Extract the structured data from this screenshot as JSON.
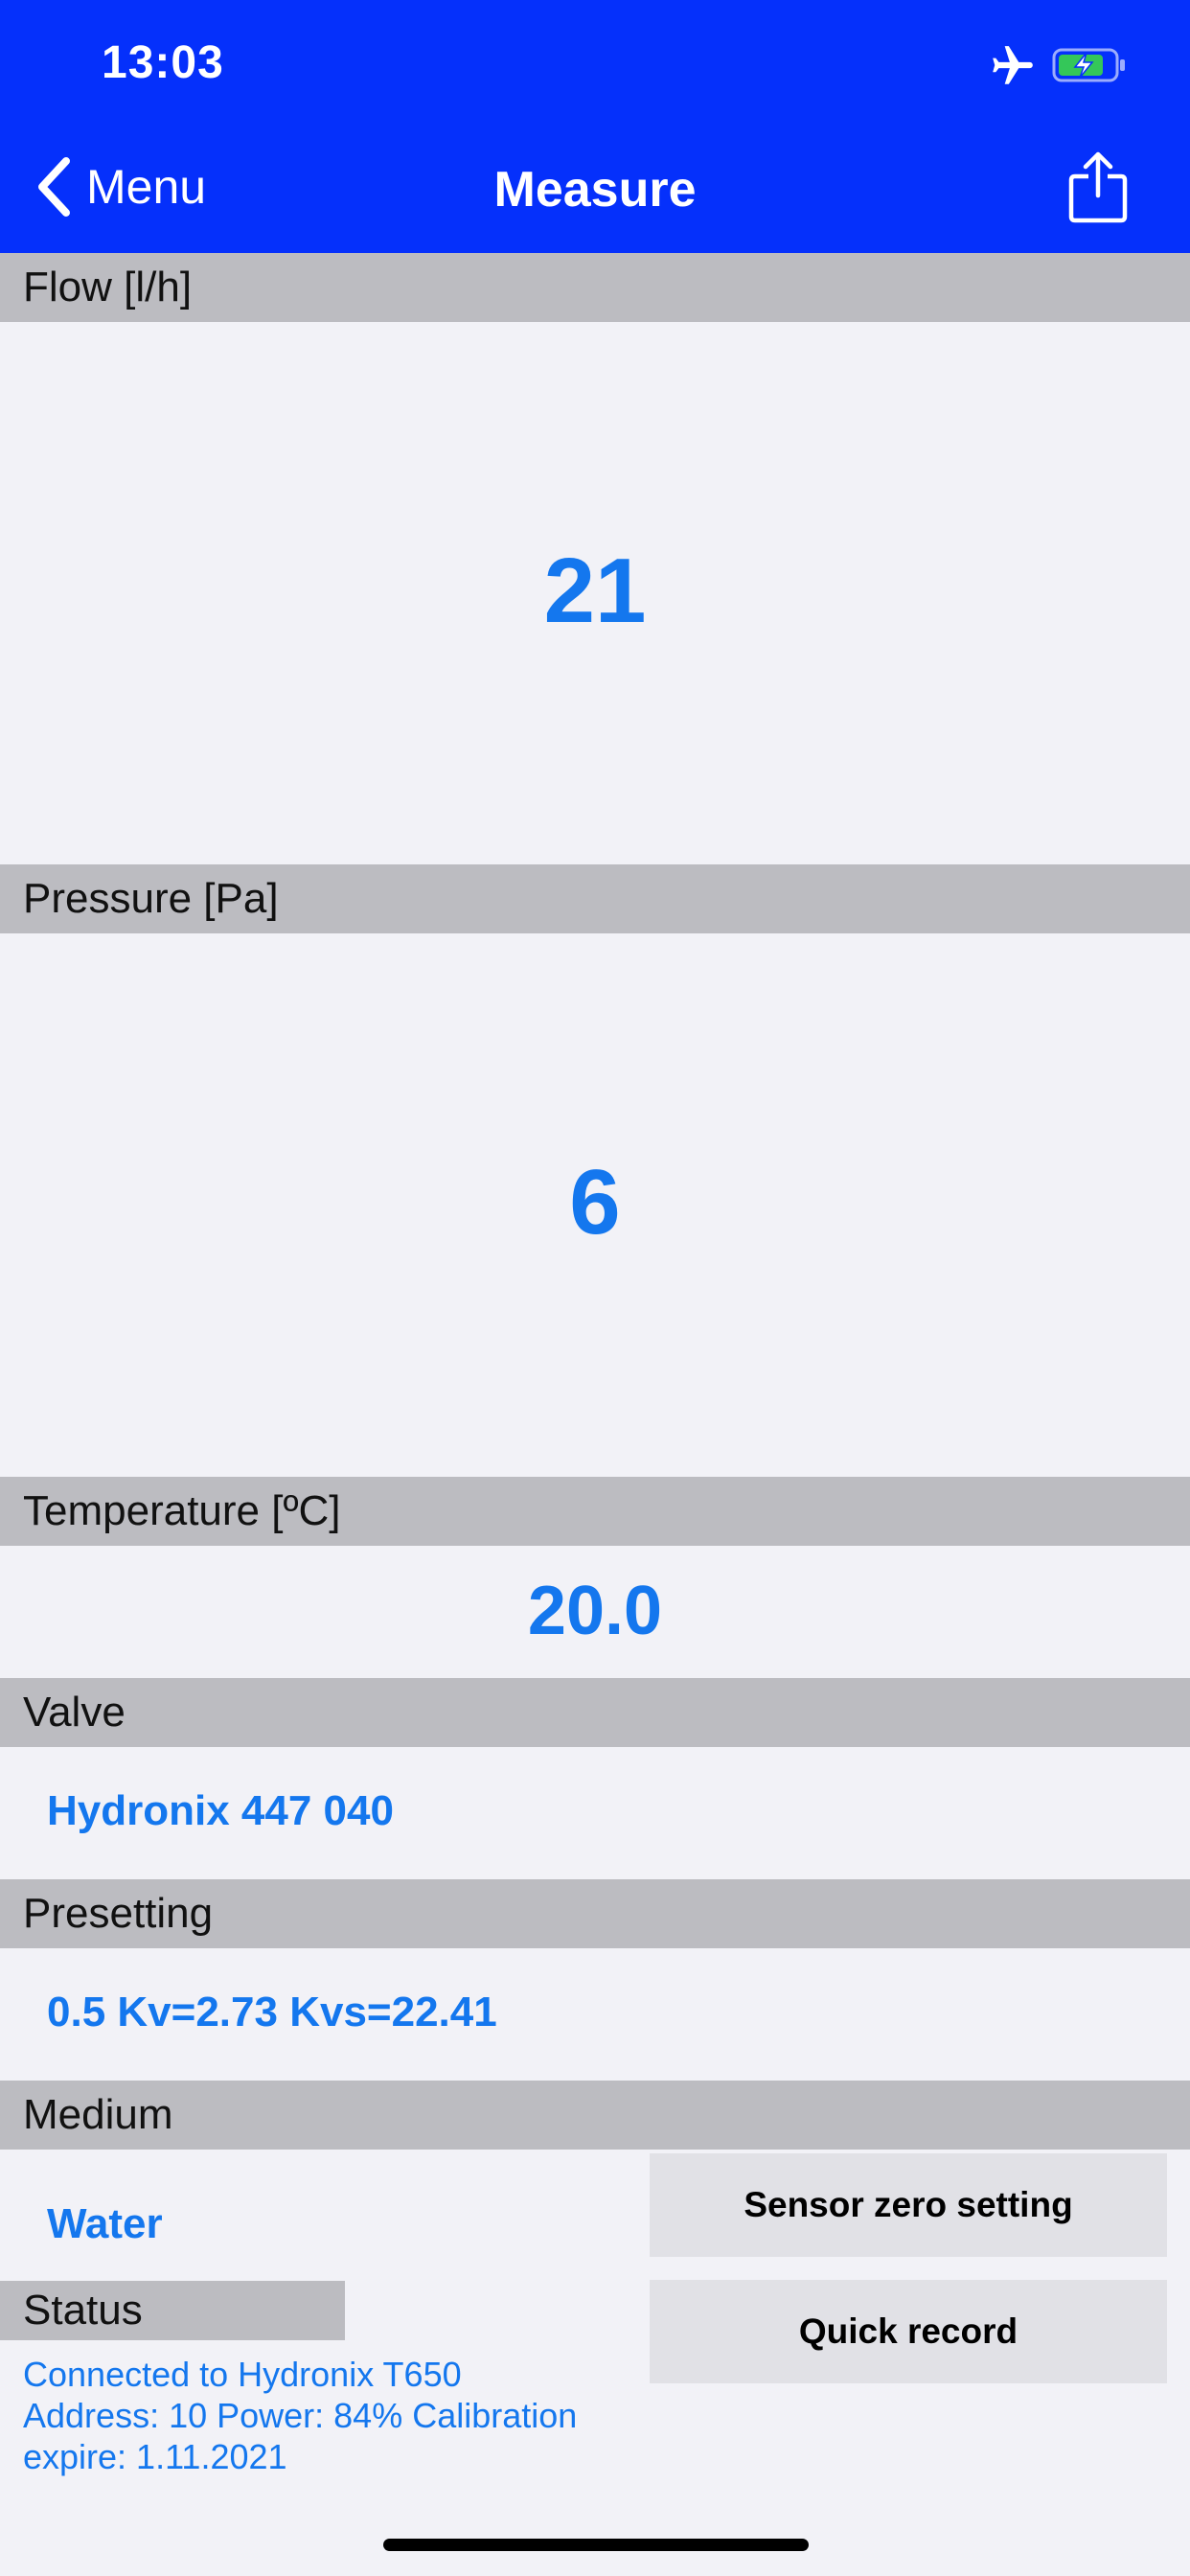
{
  "status_bar": {
    "time": "13:03",
    "airplane_icon": "airplane-icon",
    "battery_icon": "battery-charging-icon"
  },
  "nav": {
    "back_label": "Menu",
    "title": "Measure",
    "share_icon": "share-icon"
  },
  "sections": {
    "flow": {
      "header": "Flow [l/h]",
      "value": "21"
    },
    "pressure": {
      "header": "Pressure [Pa]",
      "value": "6"
    },
    "temperature": {
      "header": "Temperature [ºC]",
      "value": "20.0"
    },
    "valve": {
      "header": "Valve",
      "value": "Hydronix 447 040"
    },
    "presetting": {
      "header": "Presetting",
      "value": "0.5 Kv=2.73 Kvs=22.41"
    },
    "medium": {
      "header": "Medium",
      "value": "Water"
    }
  },
  "buttons": {
    "sensor_zero": "Sensor zero setting",
    "quick_record": "Quick record"
  },
  "status": {
    "header": "Status",
    "line1": "Connected to Hydronix T650",
    "line2": "Address: 10 Power: 84% Calibration",
    "line3": "expire: 1.11.2021"
  },
  "colors": {
    "header_blue": "#0530fb",
    "value_blue": "#1477ee",
    "section_gray": "#bcbcc1",
    "background": "#f2f2f7",
    "button_gray": "#e1e1e6",
    "battery_green": "#34c759"
  }
}
